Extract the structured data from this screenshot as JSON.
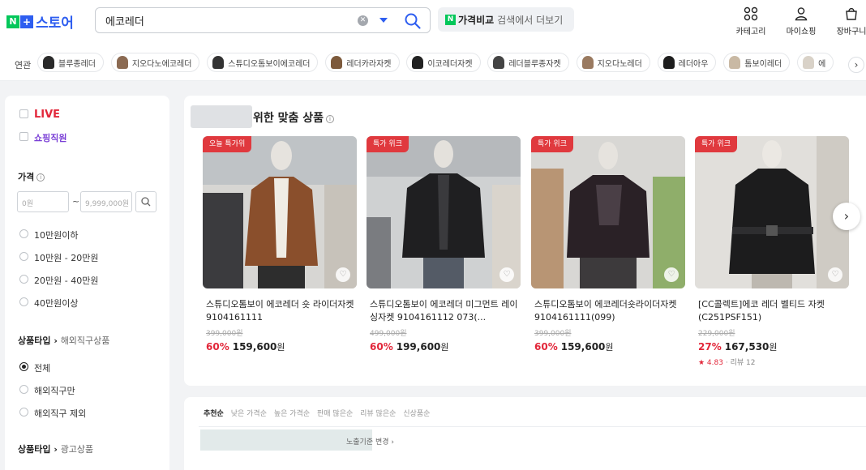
{
  "header": {
    "logo_n": "N",
    "logo_plus": "+",
    "logo_text": "스토어",
    "search_value": "에코레더",
    "clear_glyph": "✕",
    "price_compare_n": "N",
    "price_compare_bold": "가격비교",
    "price_compare_rest": "검색에서 더보기",
    "icons": [
      {
        "name": "category-icon",
        "label": "카테고리"
      },
      {
        "name": "my-icon",
        "label": "마이쇼핑"
      },
      {
        "name": "cart-icon",
        "label": "장바구니"
      }
    ]
  },
  "related": {
    "label": "연관",
    "chips": [
      "블루종레더",
      "지오다노에코레더",
      "스튜디오톰보이에코레더",
      "레더카라자켓",
      "이코레더자켓",
      "레더블루종자켓",
      "지오다노레더",
      "레더아우",
      "톰보이레더",
      "에"
    ],
    "chip_colors": [
      "#2a2a2a",
      "#8b6a52",
      "#333333",
      "#7d5a3c",
      "#222222",
      "#444444",
      "#9a7a60",
      "#1e1e1e",
      "#c9b9a4",
      "#d9d2c8"
    ],
    "next_glyph": "›"
  },
  "filters": {
    "live_label": "LIVE",
    "shopping_label": "쇼핑직원",
    "price_title": "가격",
    "price_info": "i",
    "price_min_placeholder": "0원",
    "price_max_placeholder": "9,999,000원",
    "price_tilde": "~",
    "price_options": [
      "10만원이하",
      "10만원 - 20만원",
      "20만원 - 40만원",
      "40만원이상"
    ],
    "product_type_title": "상품타입",
    "product_type_sub": "해외직구상품",
    "product_type_options": [
      "전체",
      "해외직구만",
      "해외직구 제외"
    ],
    "product_type_selected": "전체",
    "product_type2_title": "상품타입",
    "product_type2_sub": "광고상품"
  },
  "recommendations": {
    "title": "위한 맞춤 상품",
    "info": "i",
    "heart_glyph": "♡",
    "next_glyph": "›",
    "products": [
      {
        "badge": "오늘 특가위",
        "name": "스튜디오톰보이 에코레더 숏 라이더자켓 9104161111",
        "original_price": "399,000원",
        "discount": "60%",
        "price": "159,600",
        "won": "원",
        "rating": "",
        "reviews": ""
      },
      {
        "badge": "특가 위크",
        "name": "스튜디오톰보이 에코레더 미그먼트 레이싱자켓 9104161112 073(...",
        "original_price": "499,000원",
        "discount": "60%",
        "price": "199,600",
        "won": "원",
        "rating": "",
        "reviews": ""
      },
      {
        "badge": "특가 위크",
        "name": "스튜디오톰보이 에코레더숏라이더자켓9104161111(099)",
        "original_price": "399,000원",
        "discount": "60%",
        "price": "159,600",
        "won": "원",
        "rating": "",
        "reviews": ""
      },
      {
        "badge": "특가 위크",
        "name": "[CC콜렉트]에코 레더 벨티드 자켓(C251PSF151)",
        "original_price": "229,000원",
        "discount": "27%",
        "price": "167,530",
        "won": "원",
        "rating": "★ 4.83",
        "reviews": "리뷰 12"
      }
    ]
  },
  "sortbar": {
    "sorts": [
      "추천순",
      "낮은 가격순",
      "높은 가격순",
      "판매 많은순",
      "리뷰 많은순",
      "신상품순"
    ],
    "active": "추천순",
    "note": "노출기준",
    "note_link": "변경 ›"
  },
  "colors": {
    "brand_green": "#03c75a",
    "brand_blue": "#2e5ef0",
    "sale_red": "#e2273a",
    "badge_red": "#e0393e"
  }
}
